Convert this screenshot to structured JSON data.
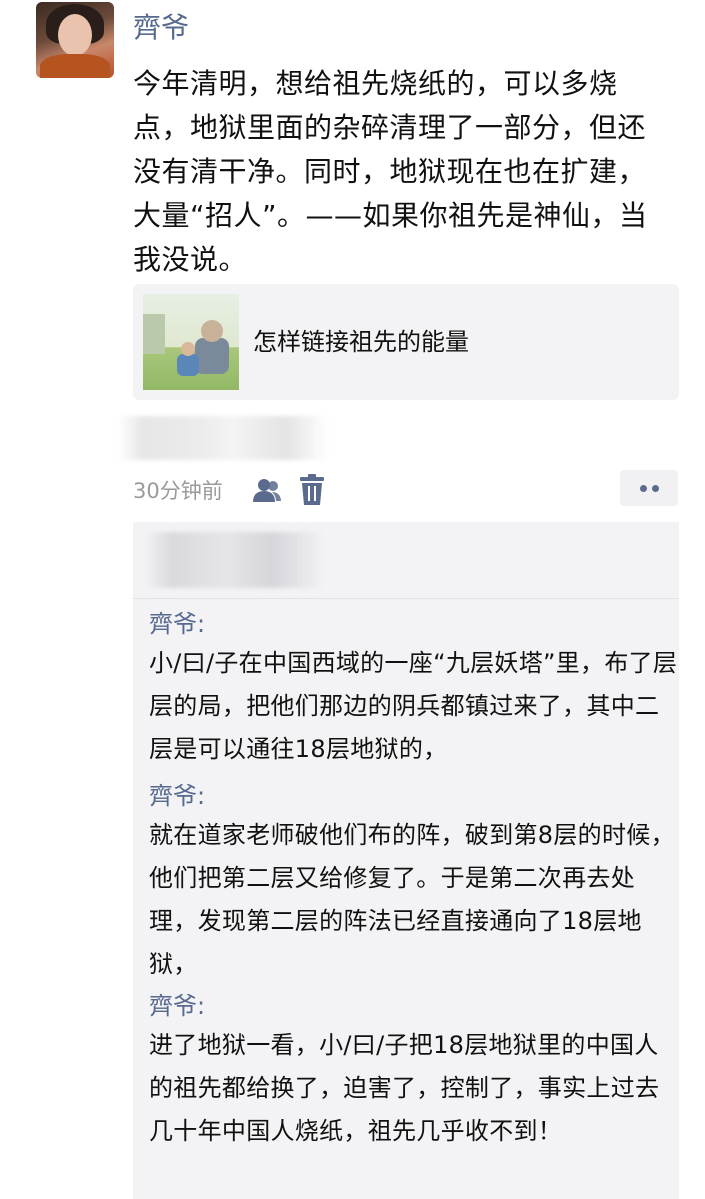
{
  "post": {
    "username": "齊爷",
    "text": "今年清明，想给祖先烧纸的，可以多烧点，地狱里面的杂碎清理了一部分，但还没有清干净。同时，地狱现在也在扩建，大量“招人”。——如果你祖先是神仙，当我没说。",
    "link_title": "怎样链接祖先的能量",
    "time": "30分钟前"
  },
  "icons": {
    "friends": "friends-visibility-icon",
    "trash": "trash-icon",
    "more": "more-dots-icon"
  },
  "comments": [
    {
      "author": "齊爷:",
      "text": "小/曰/子在中国西域的一座“九层妖塔”里，布了层层的局，把他们那边的阴兵都镇过来了，其中二层是可以通往18层地狱的，"
    },
    {
      "author": "齊爷:",
      "text": "就在道家老师破他们布的阵，破到第8层的时候，他们把第二层又给修复了。于是第二次再去处理，发现第二层的阵法已经直接通向了18层地狱，"
    },
    {
      "author": "齊爷:",
      "text": "进了地狱一看，小/曰/子把18层地狱里的中国人的祖先都给换了，迫害了，控制了，事实上过去几十年中国人烧纸，祖先几乎收不到！"
    }
  ],
  "colors": {
    "name_link": "#56698f",
    "card_bg": "#f3f3f5",
    "time_gray": "#9a9a9a"
  }
}
